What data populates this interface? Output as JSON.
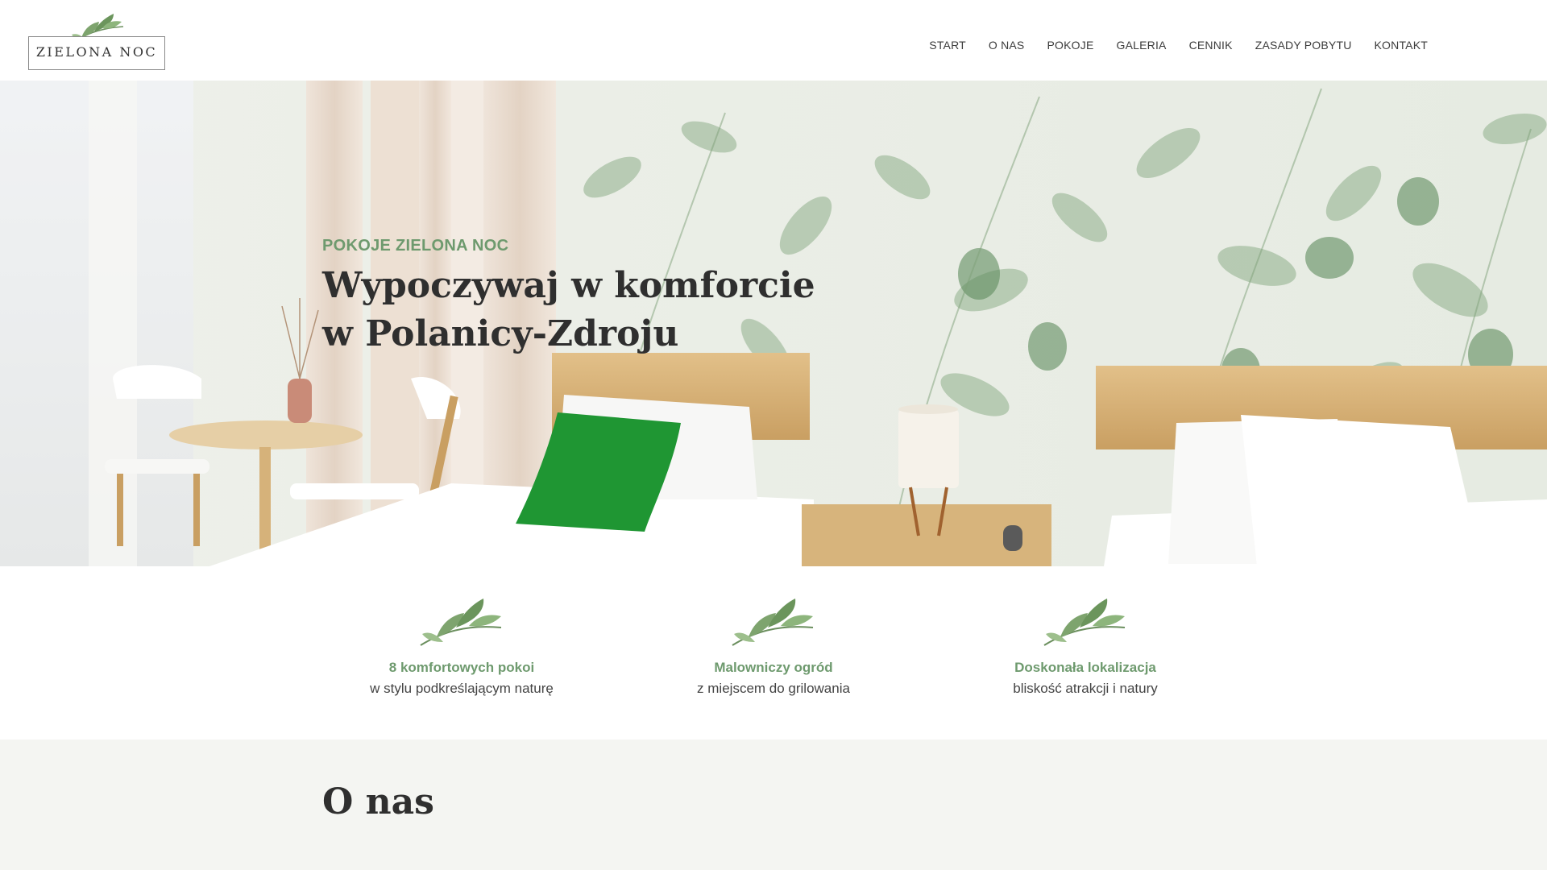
{
  "logo": {
    "text": "ZIELONA NOC",
    "icon": "leaf-icon"
  },
  "nav": {
    "items": [
      {
        "label": "START"
      },
      {
        "label": "O NAS"
      },
      {
        "label": "POKOJE"
      },
      {
        "label": "GALERIA"
      },
      {
        "label": "CENNIK"
      },
      {
        "label": "ZASADY POBYTU"
      },
      {
        "label": "KONTAKT"
      }
    ]
  },
  "hero": {
    "eyebrow": "POKOJE ZIELONA NOC",
    "title_line1": "Wypoczywaj w komforcie",
    "title_line2": "w Polanicy-Zdroju"
  },
  "features": [
    {
      "icon": "leaf-icon",
      "title": "8 komfortowych pokoi",
      "subtitle": "w stylu podkreślającym naturę"
    },
    {
      "icon": "leaf-icon",
      "title": "Malowniczy ogród",
      "subtitle": "z miejscem do grilowania"
    },
    {
      "icon": "leaf-icon",
      "title": "Doskonała lokalizacja",
      "subtitle": "bliskość atrakcji i natury"
    }
  ],
  "about": {
    "heading": "O nas"
  },
  "colors": {
    "accent_green": "#6e9a6e",
    "text_dark": "#2f2f2f",
    "about_bg": "#f4f5f2"
  }
}
